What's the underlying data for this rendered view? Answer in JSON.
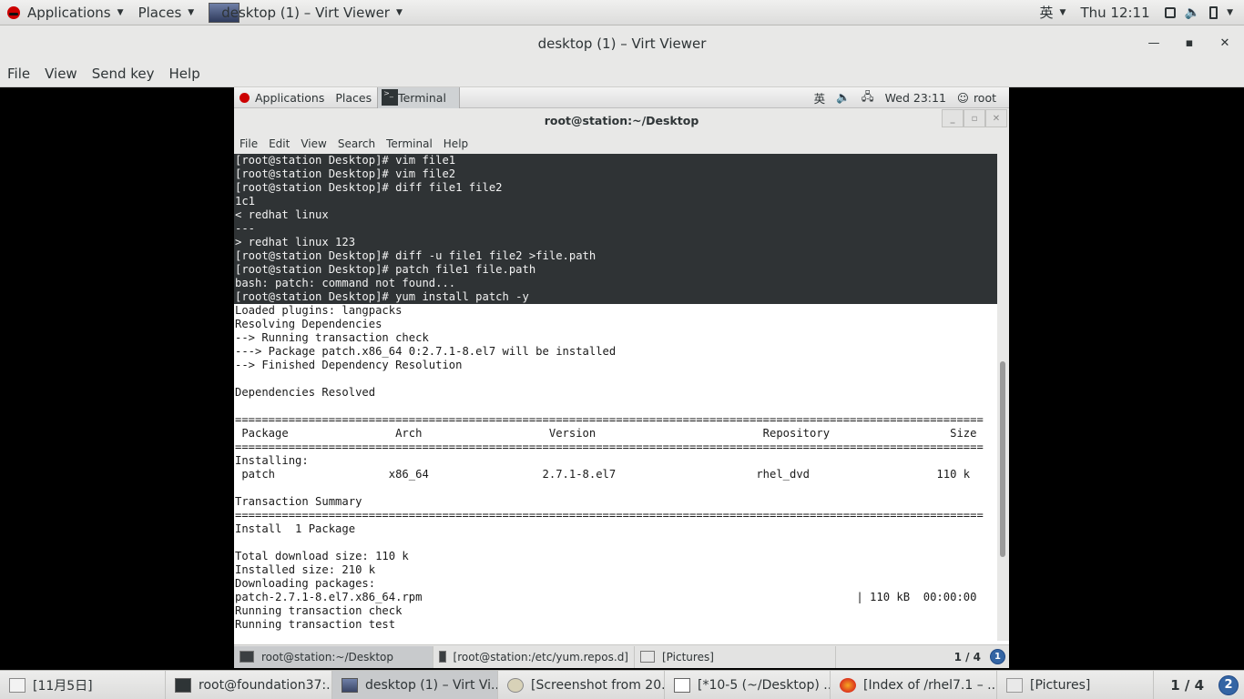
{
  "host_top": {
    "applications": "Applications",
    "places": "Places",
    "active_window": "desktop (1) – Virt Viewer",
    "ime": "英",
    "clock": "Thu 12:11"
  },
  "virt_viewer": {
    "title": "desktop (1) – Virt Viewer",
    "menu": [
      "File",
      "View",
      "Send key",
      "Help"
    ]
  },
  "guest_top": {
    "applications": "Applications",
    "places": "Places",
    "terminal": "Terminal",
    "ime": "英",
    "clock": "Wed 23:11",
    "user": "root"
  },
  "terminal": {
    "title": "root@station:~/Desktop",
    "menu": [
      "File",
      "Edit",
      "View",
      "Search",
      "Terminal",
      "Help"
    ],
    "lines": [
      "[root@station Desktop]# vim file1",
      "[root@station Desktop]# vim file2",
      "[root@station Desktop]# diff file1 file2",
      "1c1",
      "< redhat linux",
      "---",
      "> redhat linux 123",
      "[root@station Desktop]# diff -u file1 file2 >file.path",
      "[root@station Desktop]# patch file1 file.path",
      "bash: patch: command not found...",
      "[root@station Desktop]# yum install patch -y",
      "Loaded plugins: langpacks",
      "Resolving Dependencies",
      "--> Running transaction check",
      "---> Package patch.x86_64 0:2.7.1-8.el7 will be installed",
      "--> Finished Dependency Resolution",
      "",
      "Dependencies Resolved",
      "",
      "================================================================================================================",
      " Package                Arch                   Version                         Repository                  Size",
      "================================================================================================================",
      "Installing:",
      " patch                 x86_64                 2.7.1-8.el7                     rhel_dvd                   110 k",
      "",
      "Transaction Summary",
      "================================================================================================================",
      "Install  1 Package",
      "",
      "Total download size: 110 k",
      "Installed size: 210 k",
      "Downloading packages:",
      "patch-2.7.1-8.el7.x86_64.rpm                                                                 | 110 kB  00:00:00",
      "Running transaction check",
      "Running transaction test"
    ],
    "highlighted_line_count": 11
  },
  "guest_taskbar": {
    "tasks": [
      "root@station:~/Desktop",
      "[root@station:/etc/yum.repos.d]",
      "[Pictures]"
    ],
    "pager": "1 / 4",
    "badge": "1"
  },
  "host_taskbar": {
    "tasks": [
      "[11月5日]",
      "root@foundation37:...",
      "desktop (1) – Virt Vi...",
      "[Screenshot from 20...",
      "[*10-5 (~/Desktop) ...",
      "[Index of /rhel7.1 – ...",
      "[Pictures]"
    ],
    "pager": "1 / 4",
    "badge": "2"
  }
}
